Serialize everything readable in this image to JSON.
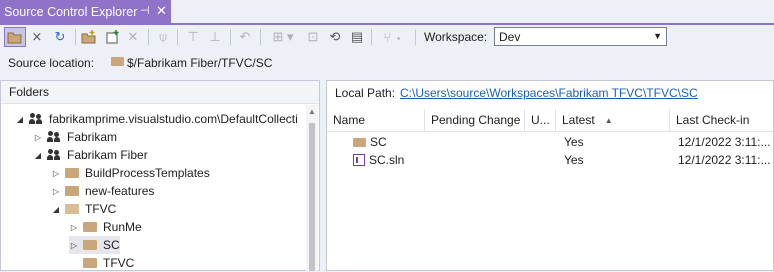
{
  "window": {
    "tab_title": "Source Control Explorer",
    "pin_glyph": "⊣",
    "close_glyph": "✕"
  },
  "toolbar": {
    "workspace_label": "Workspace:",
    "workspace_value": "Dev",
    "icons": [
      "open-folder-icon",
      "disconnect-icon",
      "refresh-icon",
      "new-folder-icon",
      "add-items-icon",
      "delete-icon",
      "branch-icon",
      "get-latest-icon",
      "check-in-icon",
      "undo-icon",
      "compare-icon",
      "view-history-icon",
      "annotate-icon",
      "branching-icon"
    ]
  },
  "source_location": {
    "label": "Source location:",
    "path": "$/Fabrikam Fiber/TFVC/SC"
  },
  "folders": {
    "header": "Folders",
    "items": [
      {
        "label": "fabrikamprime.visualstudio.com\\DefaultCollecti",
        "expander": "◢",
        "icon": "server-team",
        "indent": 0
      },
      {
        "label": "Fabrikam",
        "expander": "▷",
        "icon": "team",
        "indent": 1
      },
      {
        "label": "Fabrikam Fiber",
        "expander": "◢",
        "icon": "team",
        "indent": 1
      },
      {
        "label": "BuildProcessTemplates",
        "expander": "▷",
        "icon": "folder",
        "indent": 2
      },
      {
        "label": "new-features",
        "expander": "▷",
        "icon": "folder",
        "indent": 2
      },
      {
        "label": "TFVC",
        "expander": "◢",
        "icon": "folder-open",
        "indent": 2
      },
      {
        "label": "RunMe",
        "expander": "▷",
        "icon": "folder",
        "indent": 3
      },
      {
        "label": "SC",
        "expander": "▷",
        "icon": "folder",
        "indent": 3,
        "selected": true
      },
      {
        "label": "TFVC",
        "expander": "",
        "icon": "folder",
        "indent": 3
      }
    ]
  },
  "local_path": {
    "label": "Local Path:",
    "value": "C:\\Users\\source\\Workspaces\\Fabrikam TFVC\\TFVC\\SC"
  },
  "files": {
    "columns": [
      "Name",
      "Pending Change",
      "U...",
      "Latest",
      "Last Check-in"
    ],
    "sort_glyph": "▲",
    "rows": [
      {
        "name": "SC",
        "icon": "folder",
        "pending": "",
        "user": "",
        "latest": "Yes",
        "last_checkin": "12/1/2022 3:11:..."
      },
      {
        "name": "SC.sln",
        "icon": "solution",
        "pending": "",
        "user": "",
        "latest": "Yes",
        "last_checkin": "12/1/2022 3:11:..."
      }
    ]
  },
  "colors": {
    "accent": "#8f73c9",
    "link": "#1a5fb4",
    "folder": "#c9a77a"
  }
}
